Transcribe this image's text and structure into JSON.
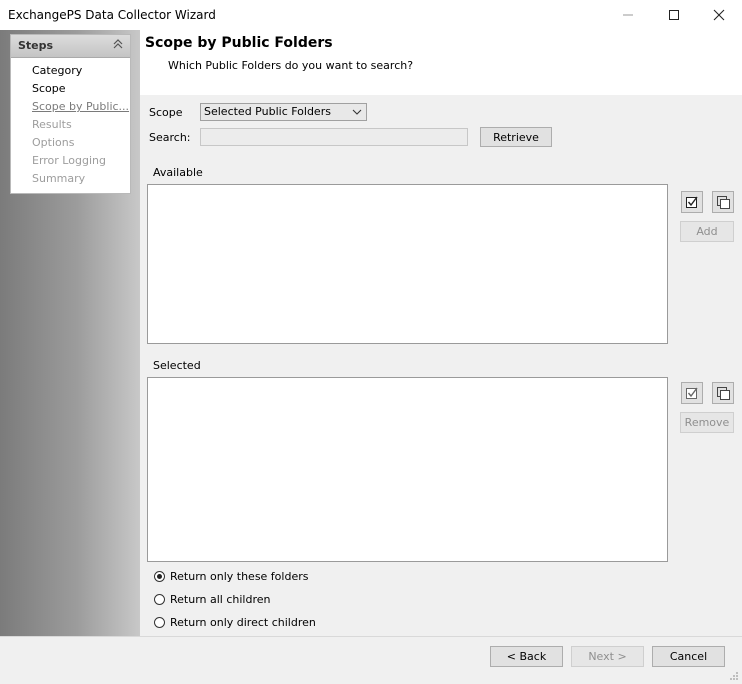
{
  "window": {
    "title": "ExchangePS Data Collector Wizard",
    "controls": [
      "minimize-icon",
      "maximize-icon",
      "close-icon"
    ]
  },
  "steps": {
    "title": "Steps",
    "items": [
      {
        "label": "Category",
        "state": "done"
      },
      {
        "label": "Scope",
        "state": "done"
      },
      {
        "label": "Scope by Public...",
        "state": "current"
      },
      {
        "label": "Results",
        "state": "disabled"
      },
      {
        "label": "Options",
        "state": "disabled"
      },
      {
        "label": "Error Logging",
        "state": "disabled"
      },
      {
        "label": "Summary",
        "state": "disabled"
      }
    ]
  },
  "header": {
    "title": "Scope by Public Folders",
    "subtitle": "Which Public Folders do you want to search?"
  },
  "scope": {
    "label": "Scope",
    "selected": "Selected Public Folders"
  },
  "search": {
    "label": "Search:",
    "value": "",
    "retrieve_label": "Retrieve"
  },
  "available": {
    "label": "Available",
    "items": [],
    "add_label": "Add"
  },
  "selected": {
    "label": "Selected",
    "items": [],
    "remove_label": "Remove"
  },
  "options": {
    "radios": [
      {
        "label": "Return only these folders",
        "checked": true
      },
      {
        "label": "Return all children",
        "checked": false
      },
      {
        "label": "Return only direct children",
        "checked": false
      }
    ]
  },
  "footer": {
    "back_label": "< Back",
    "next_label": "Next >",
    "cancel_label": "Cancel"
  }
}
